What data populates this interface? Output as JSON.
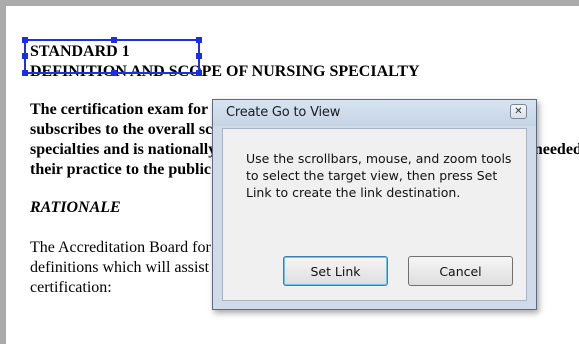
{
  "document": {
    "heading": "STANDARD 1",
    "subheading": "DEFINITION AND SCOPE OF NURSING SPECIALTY",
    "para1_lines": [
      "The certification exam for this nursing specialty is based on a role that a",
      "subscribes to the overall scope and standards of nursing practice.  The",
      "specialties and is nationally recognized. Its content reflects the knowledge needed",
      "their practice to the public and profession."
    ],
    "rationale": "RATIONALE",
    "para2_lines": [
      "The Accreditation Board for Specialty Nursing Certification, Inc.",
      "definitions which will assist in the understanding of nursing understa",
      "certification:"
    ]
  },
  "dialog": {
    "title": "Create Go to View",
    "close_glyph": "✕",
    "message": "Use the scrollbars, mouse, and zoom tools to select the target view, then press Set Link to create the link destination.",
    "set_link_label": "Set Link",
    "cancel_label": "Cancel"
  }
}
